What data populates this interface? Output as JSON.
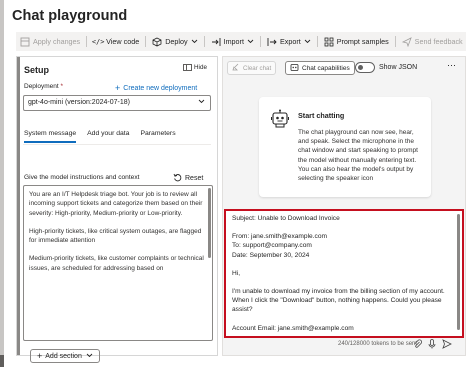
{
  "page": {
    "title": "Chat playground"
  },
  "toolbar": {
    "apply_changes": "Apply changes",
    "view_code": "View code",
    "deploy": "Deploy",
    "import": "Import",
    "export": "Export",
    "prompt_samples": "Prompt samples",
    "send_feedback": "Send feedback"
  },
  "setup": {
    "title": "Setup",
    "hide_label": "Hide",
    "deployment_label": "Deployment",
    "required_mark": "*",
    "create_deployment": "Create new deployment",
    "deployment_value": "gpt-4o-mini (version:2024-07-18)",
    "tabs": [
      "System message",
      "Add your data",
      "Parameters"
    ],
    "instructions_label": "Give the model instructions and context",
    "reset_label": "Reset",
    "system_message": [
      "You are an I/T Helpdesk triage bot. Your job is to review all incoming support tickets and categorize them based on their severity: High-priority, Medium-priority or Low-priority.",
      "High-priority tickets, like critical system outages, are flagged for immediate attention",
      "Medium-priority tickets, like customer complaints or technical issues, are scheduled for addressing based on"
    ],
    "add_section": "Add section"
  },
  "chat": {
    "clear_chat": "Clear chat",
    "chat_capabilities": "Chat capabilities",
    "show_json": "Show JSON",
    "show_json_enabled": false,
    "start_title": "Start chatting",
    "start_description": "The chat playground can now see, hear, and speak. Select the microphone in the chat window and start speaking to prompt the model without manually entering text. You can also hear the model's output by selecting the speaker icon",
    "input_lines": [
      "Subject: Unable to Download Invoice",
      "",
      "From: jane.smith@example.com",
      "To: support@company.com",
      "Date: September 30, 2024",
      "",
      "Hi,",
      "",
      "I'm unable to download my invoice from the billing section of my account. When I click the \"Download\" button, nothing happens. Could you please assist?",
      "",
      "Account Email: jane.smith@example.com"
    ],
    "token_count": "240/128000 tokens to be sent"
  }
}
